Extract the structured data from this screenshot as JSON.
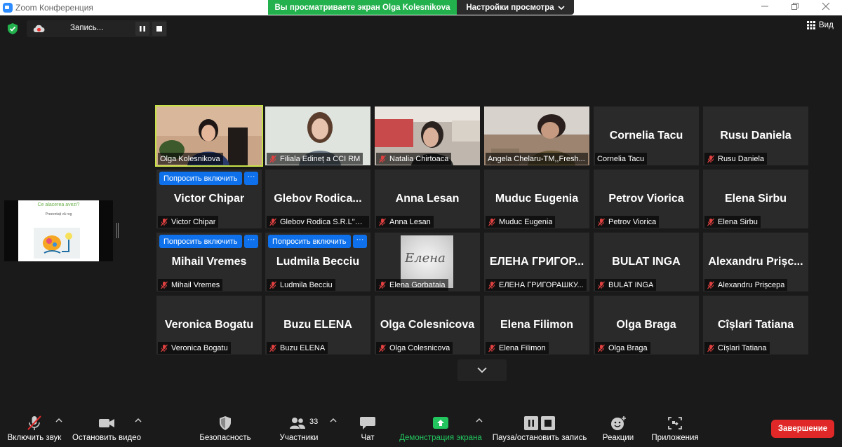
{
  "window": {
    "title": "Zoom Конференция",
    "viewing_banner": "Вы просматриваете экран Olga Kolesnikova",
    "view_settings": "Настройки просмотра",
    "min_icon": "minimize-icon",
    "max_icon": "restore-icon",
    "close_icon": "close-icon"
  },
  "recording": {
    "label": "Запись..."
  },
  "view_button": {
    "label": "Вид"
  },
  "shared_screen": {
    "title": "Ce alacerea avezi?",
    "subtitle": "Prezentați vă rog"
  },
  "ask_label": "Попросить включить",
  "dots_label": "···",
  "colors": {
    "accent": "#0e71eb",
    "active_border": "#c8e24a",
    "banner_green": "#22b14c",
    "end_red": "#e02828",
    "share_green": "#22c55e"
  },
  "tiles": [
    {
      "id": "olga-kolesnikova",
      "tag": "Olga Kolesnikova",
      "video": "woman-office",
      "active": true,
      "muted": false
    },
    {
      "id": "filiala-edinet",
      "tag": "Filiala Edineț a CCI RM",
      "video": "woman-light",
      "muted": true
    },
    {
      "id": "natalia-chirtoaca",
      "tag": "Natalia Chirtoaca",
      "video": "woman-kitchen",
      "muted": true
    },
    {
      "id": "angela-chelaru",
      "tag": "Angela Chelaru-TM,,Fresh...",
      "video": "woman-reading",
      "muted": false
    },
    {
      "id": "cornelia-tacu",
      "big": "Cornelia Tacu",
      "tag": "Cornelia Tacu",
      "muted": false
    },
    {
      "id": "rusu-daniela",
      "big": "Rusu Daniela",
      "tag": "Rusu Daniela",
      "muted": true
    },
    {
      "id": "victor-chipar",
      "big": "Victor Chipar",
      "tag": "Victor Chipar",
      "ask": true,
      "muted": true
    },
    {
      "id": "glebov-rodica",
      "big": "Glebov  Rodica...",
      "tag": "Glebov Rodica S.R.L\"NI...",
      "muted": true
    },
    {
      "id": "anna-lesan",
      "big": "Anna Lesan",
      "tag": "Anna Lesan",
      "muted": true
    },
    {
      "id": "muduc-eugenia",
      "big": "Muduc Eugenia",
      "tag": "Muduc Eugenia",
      "muted": true
    },
    {
      "id": "petrov-viorica",
      "big": "Petrov Viorica",
      "tag": "Petrov Viorica",
      "muted": true
    },
    {
      "id": "elena-sirbu",
      "big": "Elena Sirbu",
      "tag": "Elena Sirbu",
      "muted": true
    },
    {
      "id": "mihail-vremes",
      "big": "Mihail Vremes",
      "tag": "Mihail Vremes",
      "ask": true,
      "muted": true
    },
    {
      "id": "ludmila-becciu",
      "big": "Ludmila Becciu",
      "tag": "Ludmila Becciu",
      "ask": true,
      "muted": true
    },
    {
      "id": "elena-gorbataia",
      "tag": "Elena Gorbataia",
      "avatar": "Елена",
      "muted": true
    },
    {
      "id": "elena-grigorashku",
      "big": "ЕЛЕНА  ГРИГОР...",
      "tag": "ЕЛЕНА ГРИГОРАШКУ...",
      "muted": true
    },
    {
      "id": "bulat-inga",
      "big": "BULAT INGA",
      "tag": "BULAT INGA",
      "muted": true
    },
    {
      "id": "alexandru-priscepa",
      "big": "Alexandru  Prișc...",
      "tag": "Alexandru Prișcepa",
      "muted": true
    },
    {
      "id": "veronica-bogatu",
      "big": "Veronica Bogatu",
      "tag": "Veronica Bogatu",
      "muted": true
    },
    {
      "id": "buzu-elena",
      "big": "Buzu ELENA",
      "tag": "Buzu ELENA",
      "muted": true
    },
    {
      "id": "olga-colesnicova",
      "big": "Olga Colesnicova",
      "tag": "Olga Colesnicova",
      "muted": true
    },
    {
      "id": "elena-filimon",
      "big": "Elena Filimon",
      "tag": "Elena Filimon",
      "muted": true
    },
    {
      "id": "olga-braga",
      "big": "Olga Braga",
      "tag": "Olga Braga",
      "muted": true
    },
    {
      "id": "cislari-tatiana",
      "big": "Cîșlari Tatiana",
      "tag": "Cîșlari Tatiana",
      "muted": true
    }
  ],
  "toolbar": {
    "unmute": "Включить звук",
    "stop_video": "Остановить видео",
    "security": "Безопасность",
    "participants": "Участники",
    "participants_count": "33",
    "chat": "Чат",
    "share_screen": "Демонстрация экрана",
    "pause_record": "Пауза/остановить запись",
    "reactions": "Реакции",
    "apps": "Приложения",
    "end": "Завершение"
  }
}
